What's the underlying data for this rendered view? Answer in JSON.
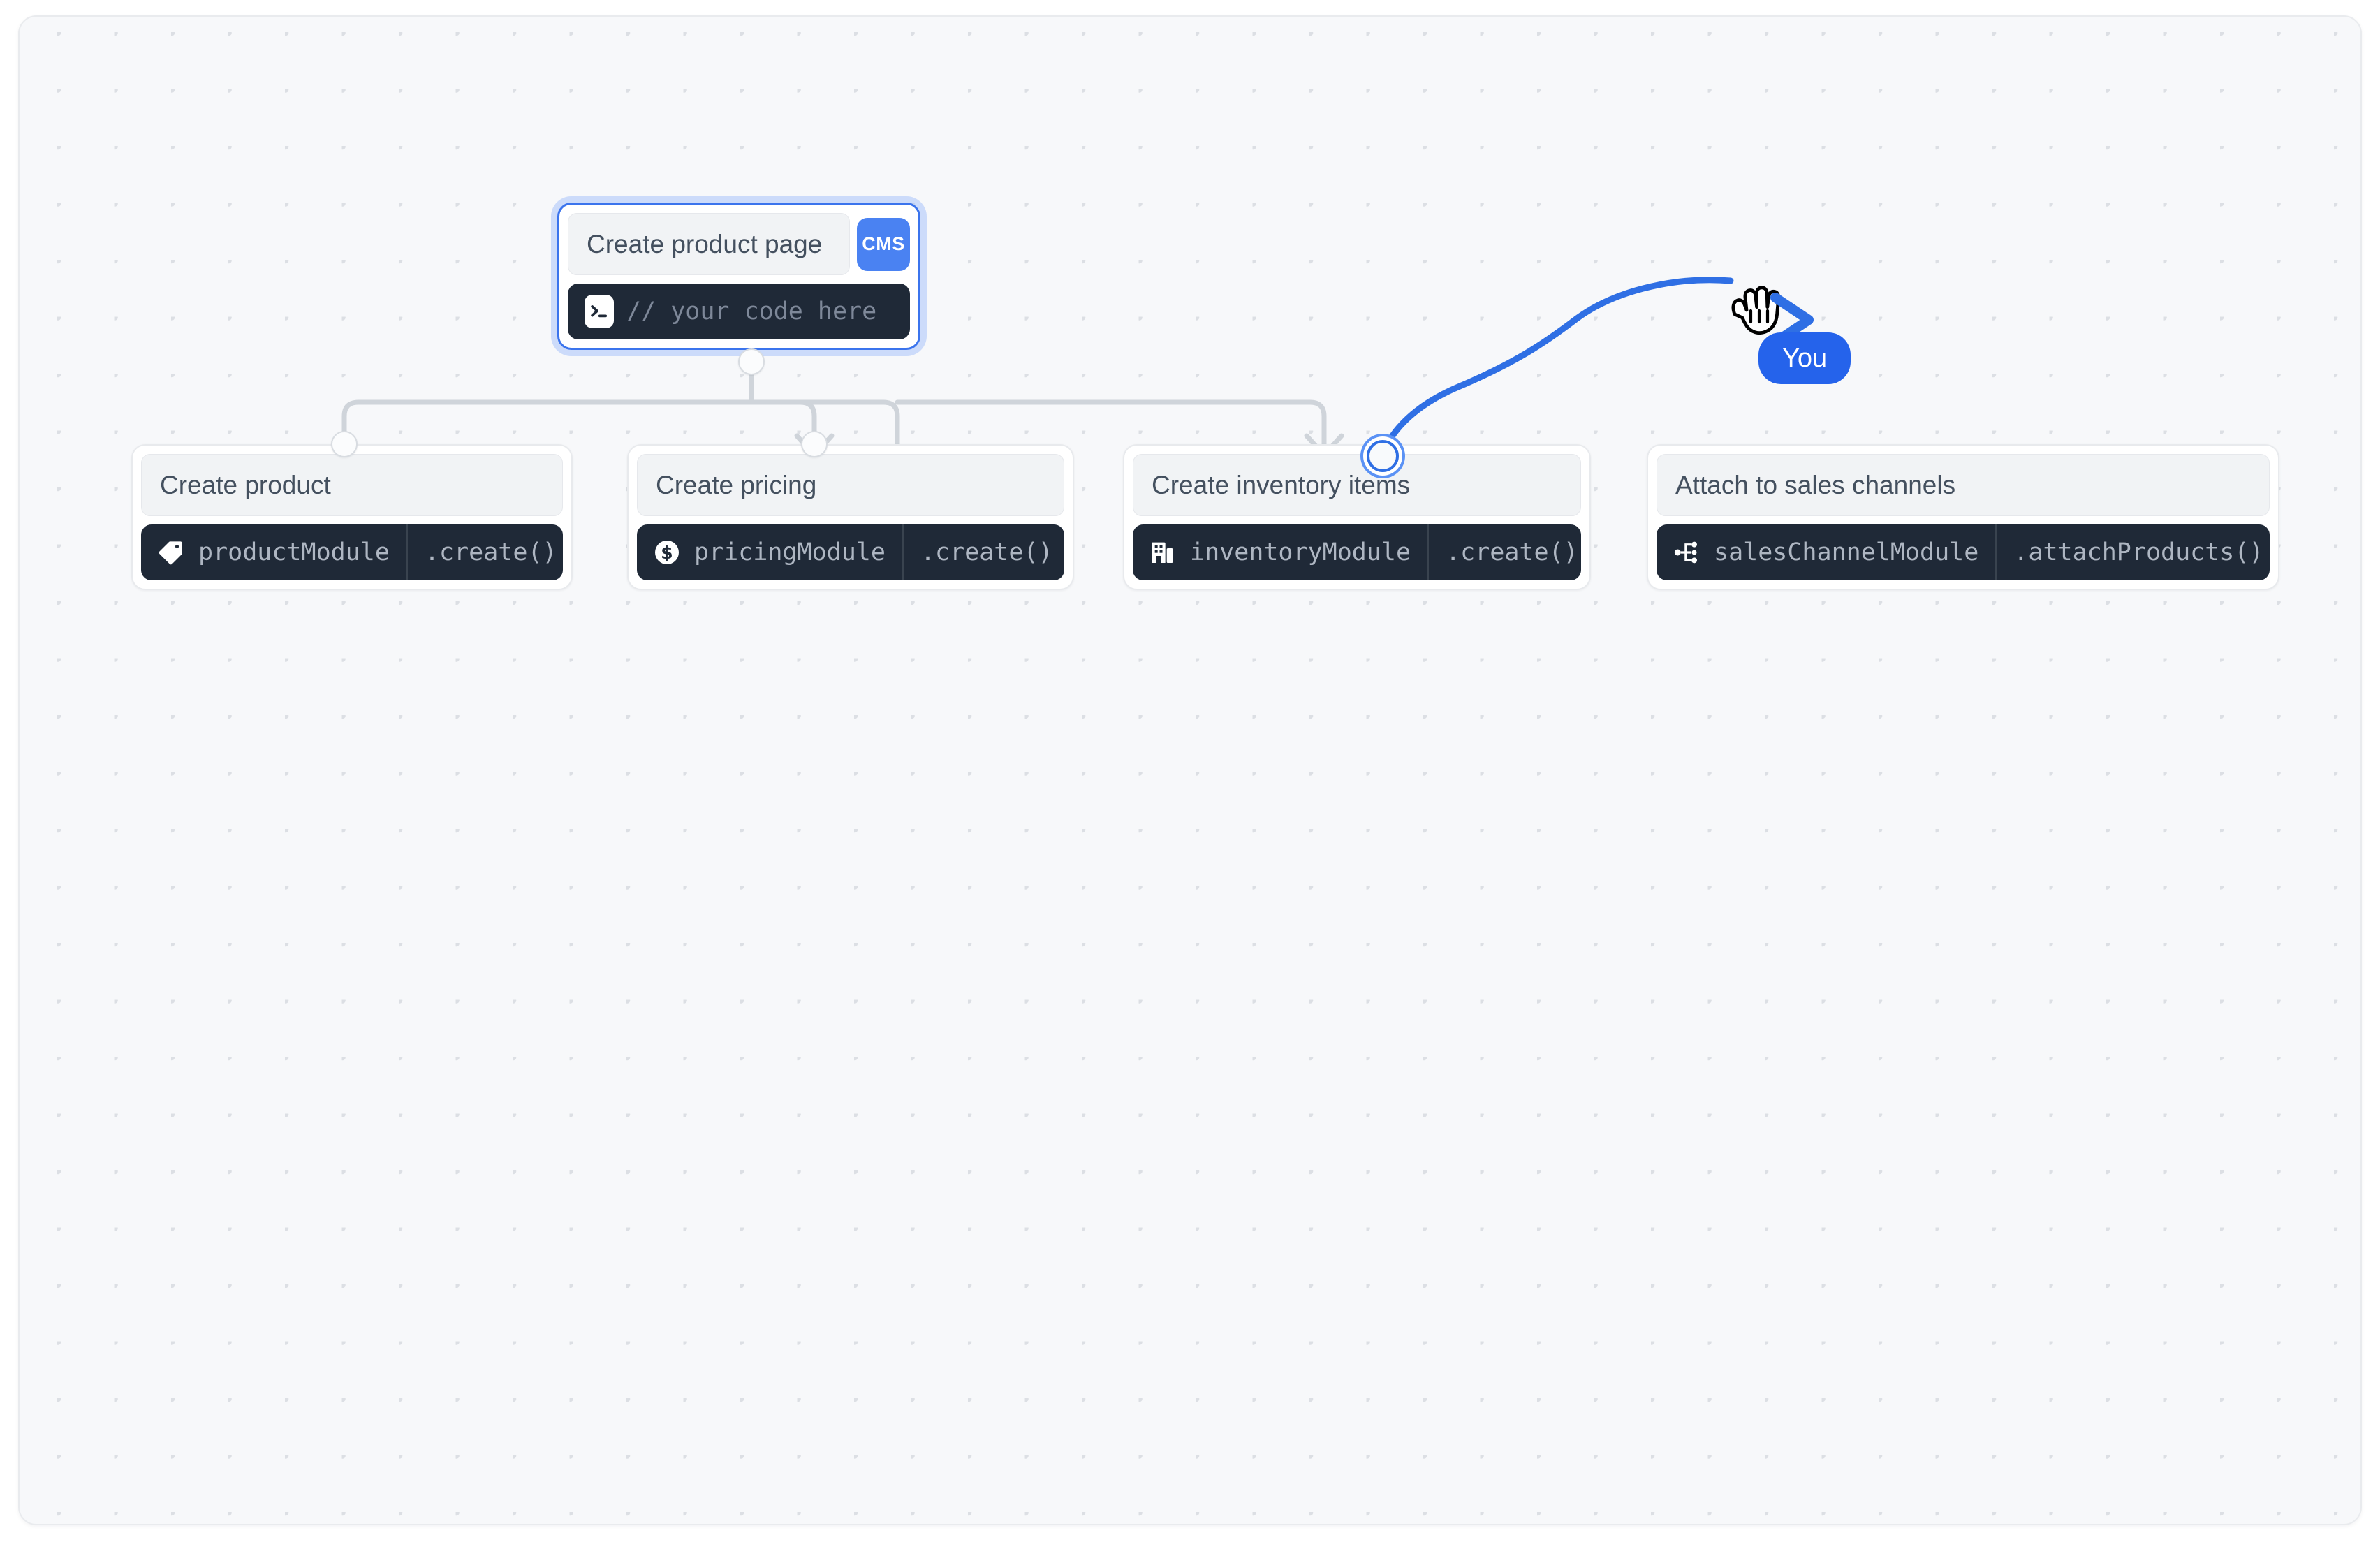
{
  "canvas": {
    "background_color": "#f7f8fa",
    "dot_color": "#dcdfe4",
    "border_color": "#e9ebee"
  },
  "theme": {
    "accent_blue": "#2563eb",
    "badge_blue": "#4a82f2",
    "selection_blue": "#3b74ed",
    "code_bg": "#1f2937",
    "code_text": "#aeb6c2",
    "header_bg": "#f1f3f5",
    "header_text": "#44505f",
    "edge_gray": "#cfd4da"
  },
  "root_node": {
    "title": "Create product page",
    "badge": "CMS",
    "badge_icon": "cms-badge",
    "code": {
      "icon": "terminal-icon",
      "text": "// your code here"
    },
    "selected": true,
    "source_handle": "source-handle-root"
  },
  "child_nodes": [
    {
      "title": "Create product",
      "icon": "tag-icon",
      "module": "productModule",
      "method": ".create()",
      "handle": "target-handle-product",
      "handle_state": "default"
    },
    {
      "title": "Create pricing",
      "icon": "dollar-circle-icon",
      "module": "pricingModule",
      "method": ".create()",
      "handle": "target-handle-pricing",
      "handle_state": "default"
    },
    {
      "title": "Create inventory items",
      "icon": "warehouse-icon",
      "module": "inventoryModule",
      "method": ".create()",
      "handle": "target-handle-inventory",
      "handle_state": "active"
    },
    {
      "title": "Attach to sales channels",
      "icon": "network-branch-icon",
      "module": "salesChannelModule",
      "method": ".attachProducts()",
      "handle": "target-handle-sales",
      "handle_state": "none"
    }
  ],
  "cursor": {
    "label": "You",
    "icon": "grabbing-hand-cursor",
    "arrow_icon": "arrow-pointer-icon",
    "color": "#2563eb"
  }
}
